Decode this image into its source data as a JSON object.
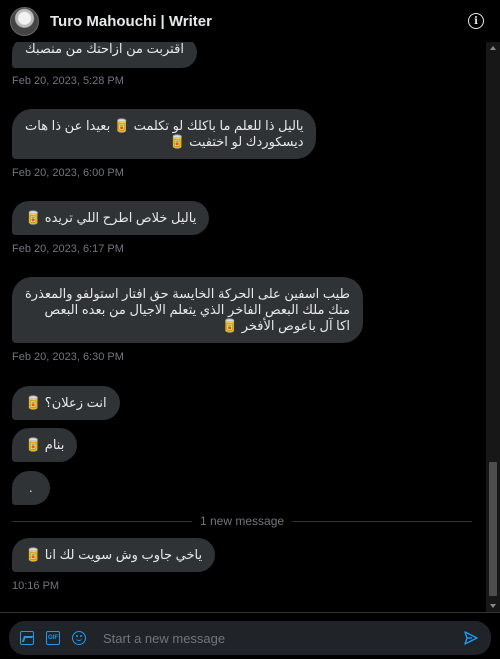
{
  "header": {
    "title": "Turo Mahouchi | Writer",
    "info_icon": "info-icon",
    "info_glyph": "i"
  },
  "messages": [
    {
      "text": "اقتربت من ازاحتك من منصبك",
      "time": "Feb 20, 2023, 5:28 PM"
    },
    {
      "line1": "ياليل ذا للعلم ما باكلك لو تكلمت 🥫 بعيدا عن ذا هات",
      "line2": "ديسكوردك لو اختفيت 🥫",
      "time": "Feb 20, 2023, 6:00 PM"
    },
    {
      "text": "ياليل خلاص اطرح اللي تريده 🥫",
      "time": "Feb 20, 2023, 6:17 PM"
    },
    {
      "line1": "طيب اسفين على الحركة الخايسة حق افتار استولفو والمعذرة",
      "line2": "منك ملك البعص الفاخر الذي يتعلم الاجيال من بعده البعص",
      "line3": "اكا آل باعوص الأفخر 🥫",
      "time": "Feb 20, 2023, 6:30 PM"
    },
    {
      "text": "انت زعلان؟ 🥫"
    },
    {
      "text": "بنام 🥫"
    },
    {
      "text": "."
    }
  ],
  "divider": {
    "label": "1 new message"
  },
  "new_message": {
    "text": "ياخي جاوب وش سويت لك انا 🥫",
    "time": "10:16 PM"
  },
  "composer": {
    "placeholder": "Start a new message",
    "gif_label": "GIF"
  },
  "colors": {
    "accent": "#1d9bf0",
    "bubble": "#2f3336",
    "background": "#000000",
    "muted": "#71767b"
  }
}
